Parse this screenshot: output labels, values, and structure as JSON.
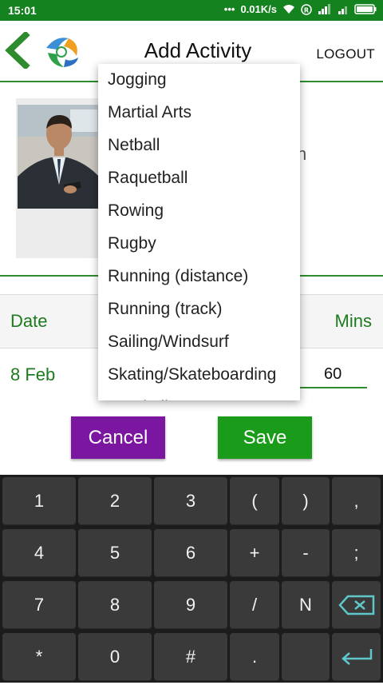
{
  "status_bar": {
    "time": "15:01",
    "network_speed": "0.01K/s",
    "bg_color": "#14821f"
  },
  "header": {
    "title": "Add Activity",
    "logout_label": "LOGOUT",
    "back_icon": "chevron-left-icon",
    "accent_color": "#2e8b2e"
  },
  "profile": {
    "obscured_text": "n"
  },
  "table": {
    "col_date": "Date",
    "col_mins": "Mins",
    "row": {
      "date": "8 Feb",
      "mins": "60"
    }
  },
  "buttons": {
    "cancel": "Cancel",
    "save": "Save",
    "cancel_color": "#7a16a0",
    "save_color": "#1a9b1a"
  },
  "dropdown": {
    "items": [
      "Jogging",
      "Martial Arts",
      "Netball",
      "Raquetball",
      "Rowing",
      "Rugby",
      "Running  (distance)",
      "Running (track)",
      "Sailing/Windsurf",
      "Skating/Skateboarding",
      "Snorkeling"
    ]
  },
  "keyboard": {
    "rows": [
      [
        "1",
        "2",
        "3",
        "(",
        ")",
        ","
      ],
      [
        "4",
        "5",
        "6",
        "+",
        "-",
        ";"
      ],
      [
        "7",
        "8",
        "9",
        "/",
        "N",
        "backspace"
      ],
      [
        "*",
        "0",
        "#",
        ".",
        "",
        "enter"
      ]
    ]
  }
}
